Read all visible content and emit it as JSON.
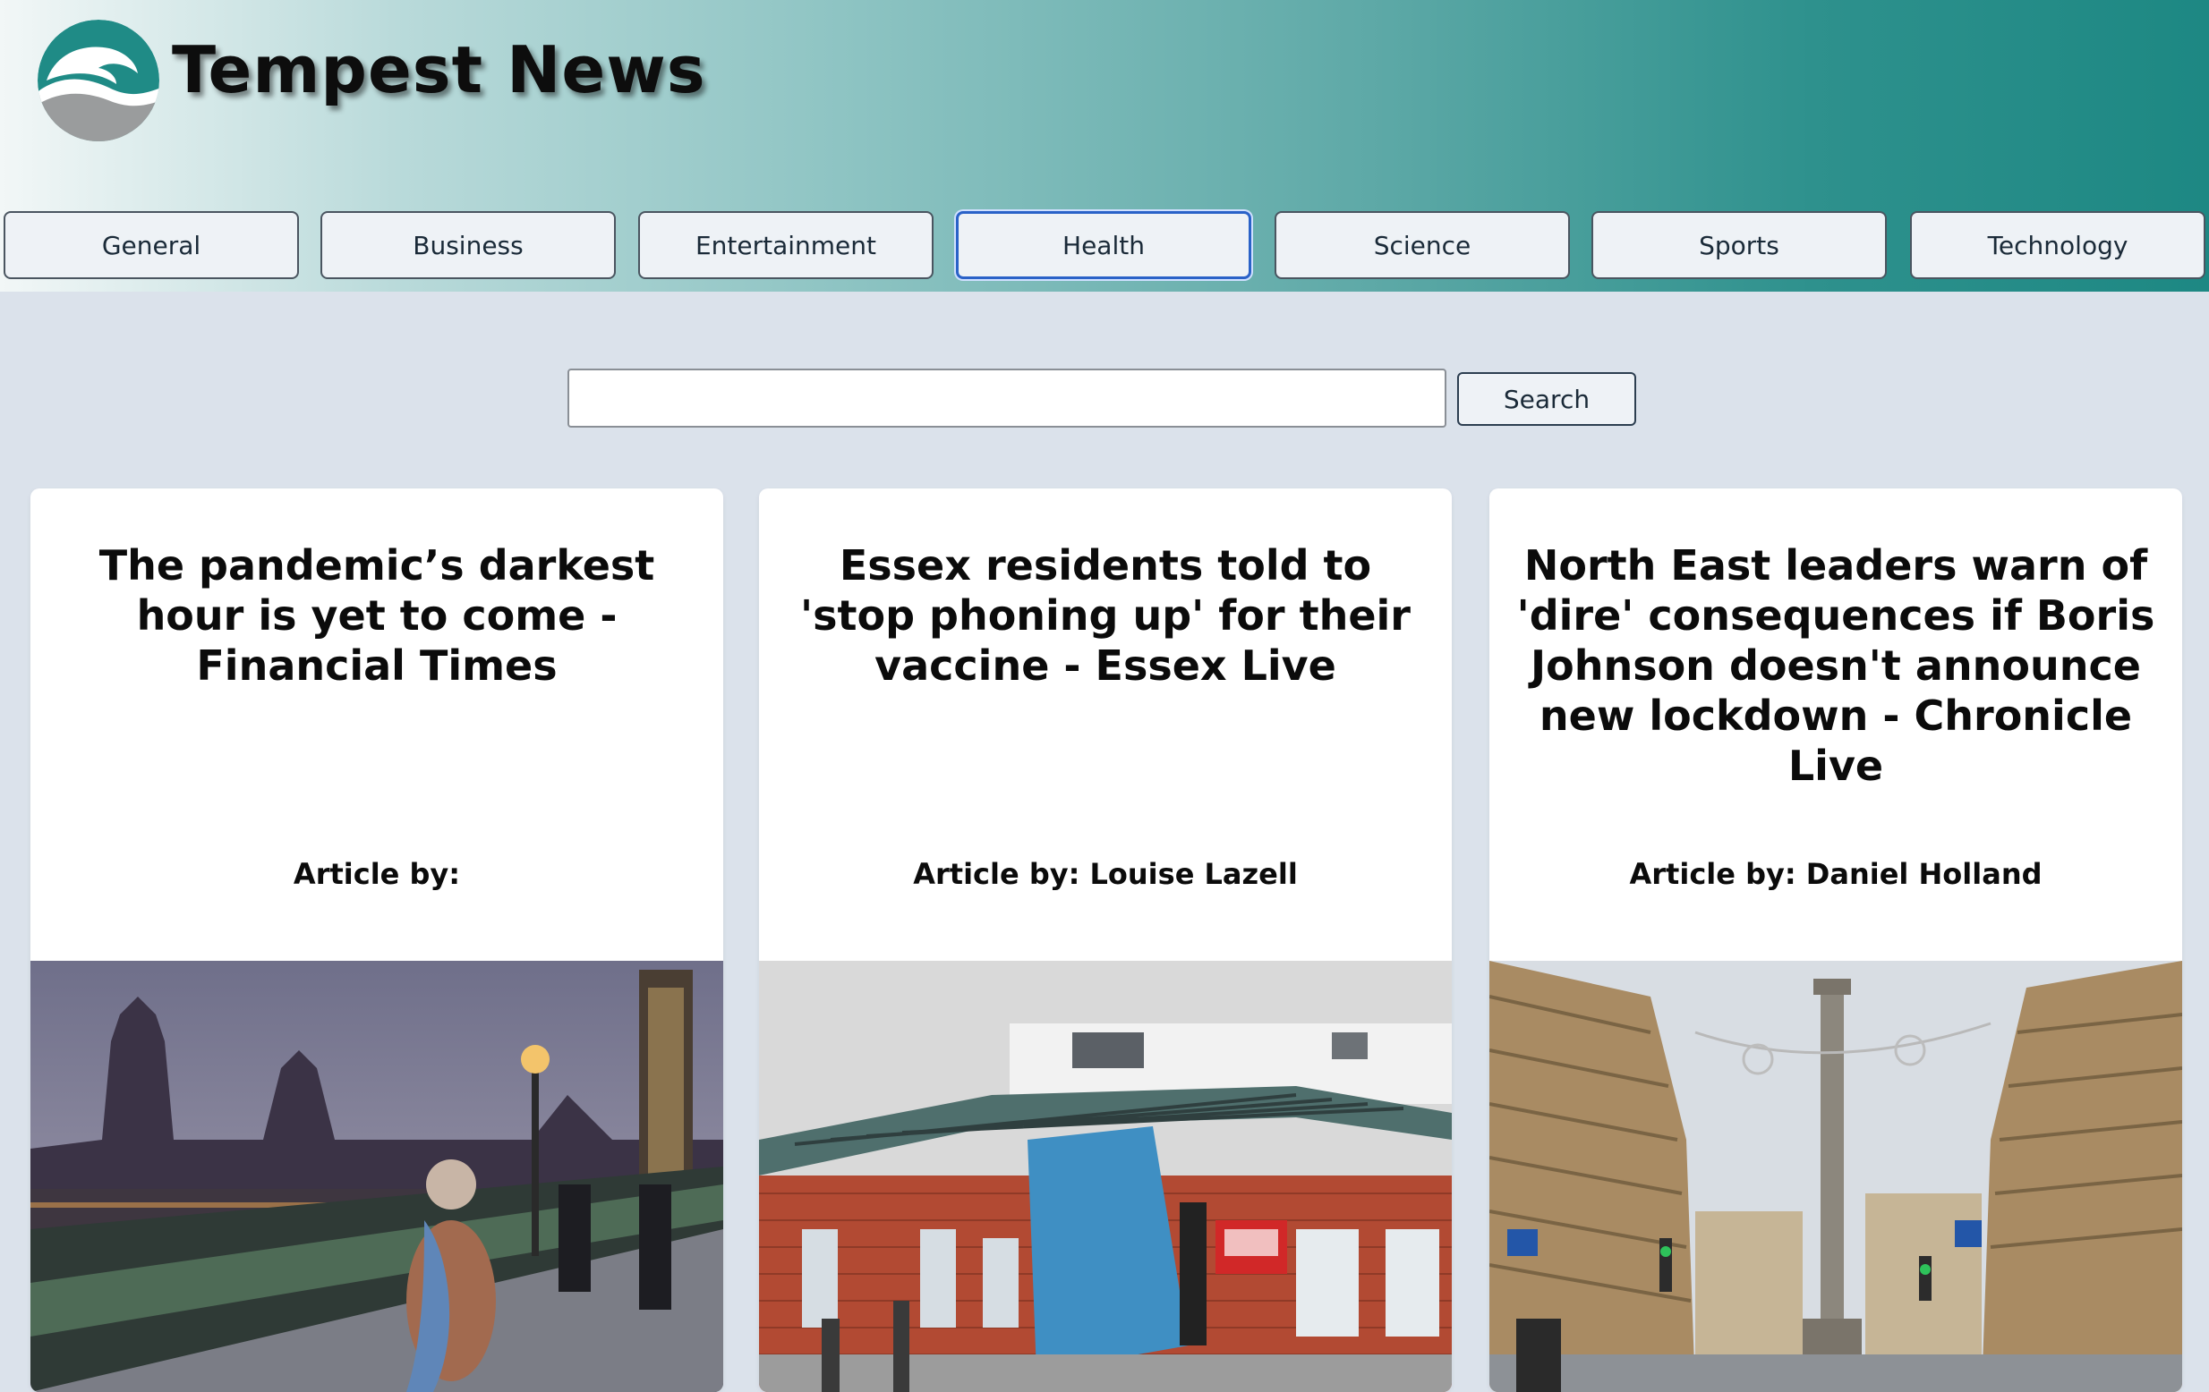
{
  "site": {
    "title": "Tempest News",
    "logo": "wave-logo-icon"
  },
  "colors": {
    "header_start": "#f2f7f7",
    "header_end": "#1d8883",
    "background": "#dbe2eb",
    "active_border": "#2a62c8"
  },
  "nav": {
    "active": "Health",
    "items": [
      {
        "label": "General"
      },
      {
        "label": "Business"
      },
      {
        "label": "Entertainment"
      },
      {
        "label": "Health"
      },
      {
        "label": "Science"
      },
      {
        "label": "Sports"
      },
      {
        "label": "Technology"
      }
    ]
  },
  "search": {
    "value": "",
    "button_label": "Search"
  },
  "articles": [
    {
      "title": "The pandemic’s darkest hour is yet to come - Financial Times",
      "author_line": "Article by:",
      "image": "westminster-bridge-photo"
    },
    {
      "title": "Essex residents told to 'stop phoning up' for their vaccine - Essex Live",
      "author_line": "Article by: Louise Lazell",
      "image": "healthcare-building-photo"
    },
    {
      "title": "North East leaders warn of 'dire' consequences if Boris Johnson doesn't announce new lockdown - Chronicle Live",
      "author_line": "Article by: Daniel Holland",
      "image": "newcastle-street-photo"
    }
  ]
}
